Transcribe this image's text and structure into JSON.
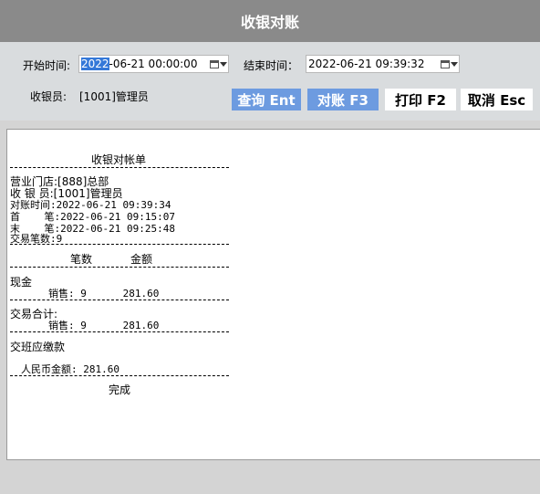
{
  "window": {
    "title": "收银对账"
  },
  "filters": {
    "start_label": "开始时间:",
    "start_value_selected": "2022",
    "start_value_rest": "-06-21 00:00:00",
    "end_label": "结束时间：",
    "end_value": "2022-06-21 09:39:32",
    "cashier_label": "收银员:",
    "cashier_value": "[1001]管理员"
  },
  "buttons": {
    "query": "查询 Ent",
    "reconcile": "对账 F3",
    "print": "打印 F2",
    "cancel": "取消 Esc"
  },
  "report": {
    "title": "收银对帐单",
    "store": "营业门店:[888]总部",
    "cashier": "收 银 员:[1001]管理员",
    "reconcile_time": "对账时间:2022-06-21 09:39:34",
    "first_txn": "首    笔:2022-06-21 09:15:07",
    "last_txn": "末    笔:2022-06-21 09:25:48",
    "txn_count": "交易笔数:9",
    "col_count": "笔数",
    "col_amount": "金额",
    "cash_section": "现金",
    "cash_sales": "销售: 9      281.60",
    "total_section": "交易合计:",
    "total_sales": "销售: 9      281.60",
    "handover_section": "交班应缴款",
    "rmb_amount": "人民币金额: 281.60",
    "done": "完成"
  },
  "colors": {
    "titlebar": "#8a8a8a",
    "button_blue": "#6d9be0",
    "selection": "#3478d8"
  }
}
